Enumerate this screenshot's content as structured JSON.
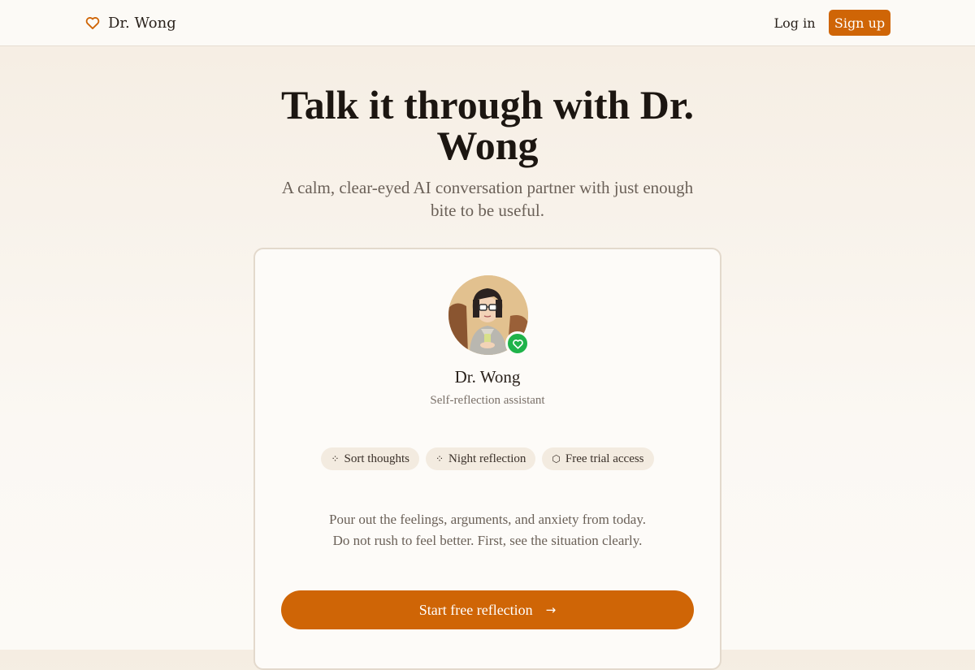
{
  "header": {
    "brand_name": "Dr. Wong",
    "brand_icon": "heart-outline-icon",
    "login_label": "Log in",
    "signup_label": "Sign up"
  },
  "hero": {
    "title": "Talk it through with Dr. Wong",
    "subtitle": "A calm, clear-eyed AI conversation partner with just enough bite to be useful."
  },
  "card": {
    "avatar": "dr-wong-cartoon-avatar",
    "status_badge_icon": "heart-icon",
    "name": "Dr. Wong",
    "role": "Self-reflection assistant",
    "tags": [
      {
        "icon": "sparkle-icon",
        "glyph": "⁘",
        "label": "Sort thoughts"
      },
      {
        "icon": "sparkle-icon",
        "glyph": "⁘",
        "label": "Night reflection"
      },
      {
        "icon": "shield-icon",
        "glyph": "⬡",
        "label": "Free trial access"
      }
    ],
    "description_line1": "Pour out the feelings, arguments, and anxiety from today.",
    "description_line2": "Do not rush to feel better. First, see the situation clearly.",
    "cta_label": "Start free reflection",
    "cta_icon": "arrow-right-icon"
  },
  "colors": {
    "accent": "#cf6506",
    "badge_green": "#1fb34a",
    "background": "#f8f2ea"
  }
}
